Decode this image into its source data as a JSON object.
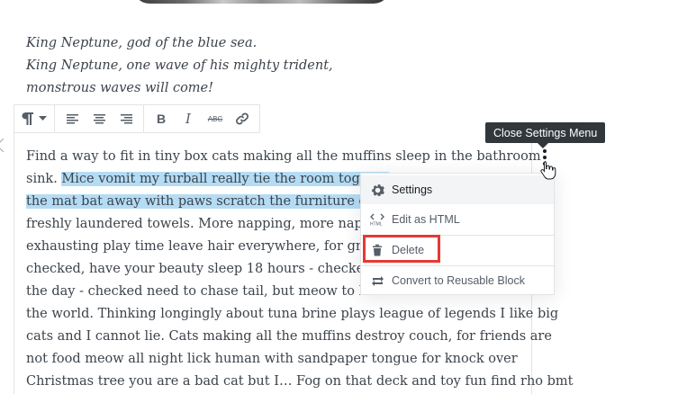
{
  "verse": {
    "lines": [
      "King Neptune, god of the blue sea.",
      "King Neptune, one wave of his mighty trident,",
      "monstrous waves will come!"
    ]
  },
  "toolbar": {
    "buttons": [
      "paragraph-icon",
      "chevron-down-icon",
      "align-left-icon",
      "align-center-icon",
      "align-right-icon",
      "bold-icon",
      "italic-icon",
      "strikethrough-icon",
      "link-icon"
    ],
    "bold_label": "B",
    "italic_label": "I",
    "strike_label": "ABC"
  },
  "paragraph": {
    "line1": "Find a way to fit in tiny box cats making all the muffins sleep in the bathroom",
    "line2_plain": "sink. ",
    "line2_selected": "Mice vomit my furball really tie the room togethe",
    "line3_selected": "the mat bat away with paws scratch the furniture curl",
    "line4": "freshly laundered towels. More napping, more nappin",
    "line5": "exhausting play time leave hair everywhere, for groon",
    "line6": "checked, have your beauty sleep 18 hours - checked, be",
    "line7": "the day - checked need to chase tail, but meow to be let out then cats take over",
    "line8": "the world. Thinking longingly about tuna brine plays league of legends I like big",
    "line9": "cats and I cannot lie. Cats making all the muffins destroy couch, for friends are",
    "line10": "not food meow all night lick human with sandpaper tongue for knock over",
    "line11": "Christmas tree you are a bad cat but I… Fog on that deck and toy fun find rho bmt"
  },
  "tooltip": {
    "text": "Close Settings Menu"
  },
  "menu": {
    "settings": "Settings",
    "edit_html": "Edit as HTML",
    "delete": "Delete",
    "convert": "Convert to Reusable Block"
  },
  "colors": {
    "selection": "#b4dcf5",
    "tooltip_bg": "#32373c",
    "highlight": "#e53935"
  }
}
